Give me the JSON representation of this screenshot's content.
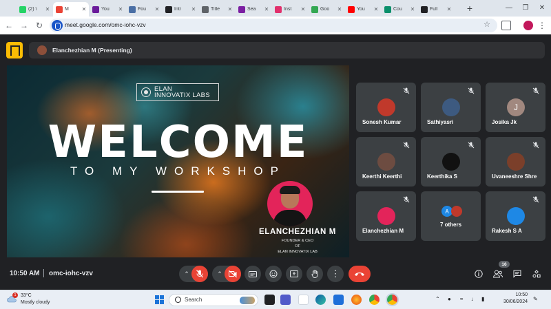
{
  "browser": {
    "tabs": [
      {
        "label": "(2) \\",
        "color": "#25d366"
      },
      {
        "label": "M",
        "color": "#ea4335"
      },
      {
        "label": "You",
        "color": "#6a1b9a"
      },
      {
        "label": "Fou",
        "color": "#4a6fa5"
      },
      {
        "label": "Intr",
        "color": "#202124"
      },
      {
        "label": "Title",
        "color": "#5f6368"
      },
      {
        "label": "Sea",
        "color": "#7b1fa2"
      },
      {
        "label": "Inst",
        "color": "#e1306c"
      },
      {
        "label": "Goo",
        "color": "#34a853"
      },
      {
        "label": "You",
        "color": "#ff0000"
      },
      {
        "label": "Cou",
        "color": "#0a8f6b"
      },
      {
        "label": "Full",
        "color": "#202124"
      }
    ],
    "url": "meet.google.com/omc-iohc-vzv"
  },
  "meet": {
    "presenter_label": "Elanchezhian M (Presenting)",
    "slide": {
      "logo_text": "ELAN\nINNOVATIX LABS",
      "title": "WELCOME",
      "subtitle": "TO MY WORKSHOP",
      "name": "ELANCHEZHIAN M",
      "role": "FOUNDER & CEO\nOF\nELAN INNOVATIX LAB"
    },
    "participants": [
      {
        "name": "Sonesh Kumar",
        "avatar_color": "#c0392b"
      },
      {
        "name": "Sathiyasri",
        "avatar_color": "#3d5a80"
      },
      {
        "name": "Josika Jk",
        "avatar_color": "#a1887f",
        "initial": "J"
      },
      {
        "name": "Keerthi Keerthi",
        "avatar_color": "#6d4c41"
      },
      {
        "name": "Keerthika S",
        "avatar_color": "#111111"
      },
      {
        "name": "Uvaneeshre Shre",
        "avatar_color": "#7b3f2a"
      },
      {
        "name": "Elanchezhian M",
        "avatar_color": "#e3245a"
      },
      {
        "name": "Rakesh S A",
        "avatar_color": "#1e88e5"
      }
    ],
    "others": {
      "label": "7 others",
      "initial": "A",
      "colors": [
        "#1e88e5",
        "#c0392b"
      ]
    },
    "time": "10:50 AM",
    "meeting_code": "omc-iohc-vzv",
    "people_count": "16"
  },
  "taskbar": {
    "temperature": "33°C",
    "weather": "Mostly cloudy",
    "weather_badge": "1",
    "search_label": "Search",
    "clock_time": "10:50",
    "clock_date": "30/06/2024"
  }
}
